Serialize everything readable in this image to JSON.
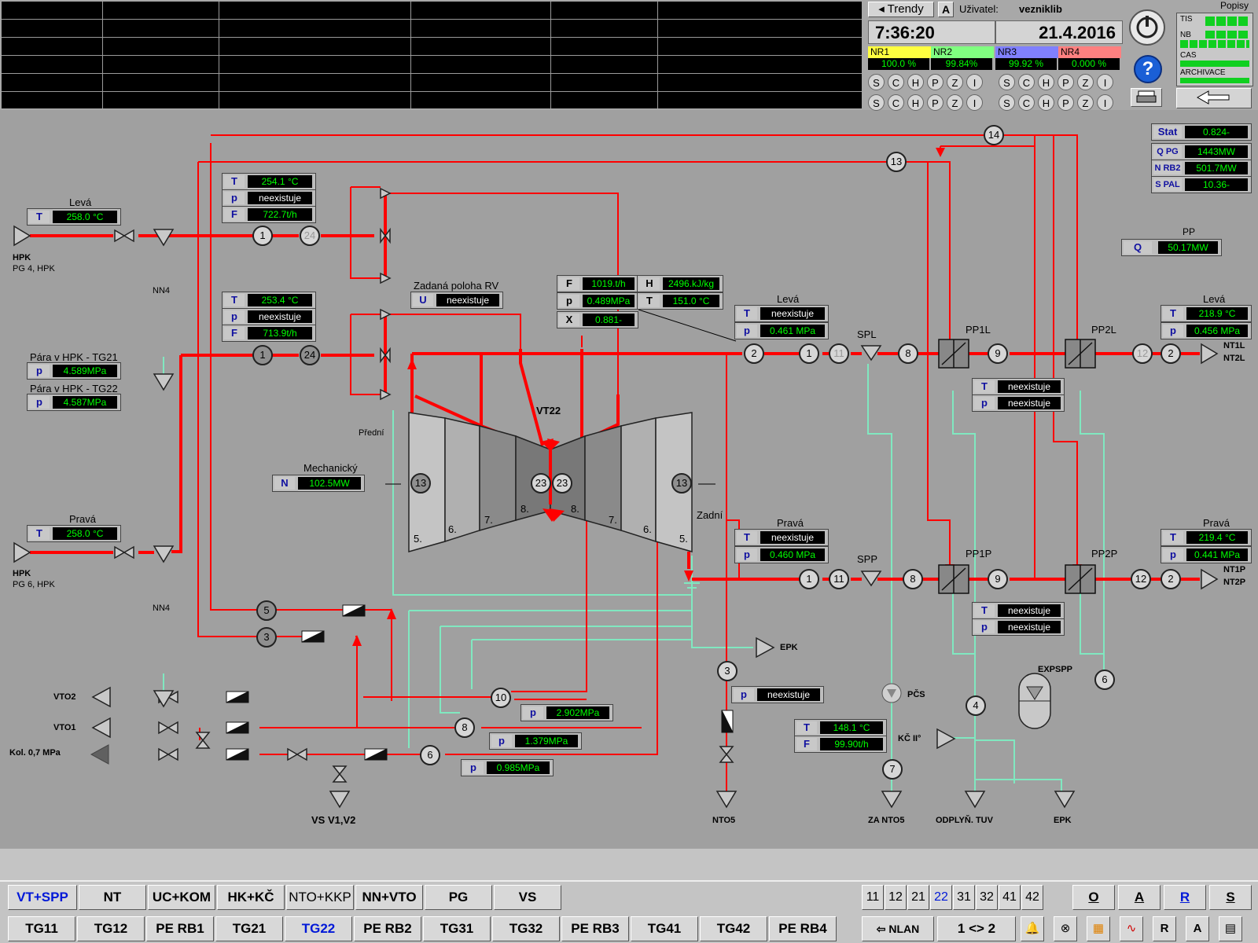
{
  "header": {
    "trendy": "◂ Trendy",
    "a_btn": "A",
    "user_label": "Uživatel:",
    "user_name": "vezniklib",
    "time": "7:36:20",
    "date": "21.4.2016",
    "popisy": "Popisy",
    "nr": [
      {
        "label": "NR1",
        "value": "100.0 %",
        "color": "#ffff40"
      },
      {
        "label": "NR2",
        "value": "99.84%",
        "color": "#80ff80"
      },
      {
        "label": "NR3",
        "value": "99.92 %",
        "color": "#8080ff"
      },
      {
        "label": "NR4",
        "value": "0.000 %",
        "color": "#ff8080"
      }
    ],
    "sch": [
      "S",
      "C",
      "H",
      "P",
      "Z",
      "I"
    ],
    "status_labels": [
      "TIS",
      "NB",
      "CAS",
      "ARCHIVACE"
    ]
  },
  "schema": {
    "stat": {
      "tag": "Stat",
      "value": "0.824-"
    },
    "qpg": {
      "tag": "Q PG",
      "value": "1443MW"
    },
    "nrb2": {
      "tag": "N RB2",
      "value": "501.7MW"
    },
    "spal": {
      "tag": "S PAL",
      "value": "10.36-"
    },
    "pp": {
      "label": "PP",
      "tag": "Q",
      "value": "50.17MW"
    },
    "levaTop": {
      "label": "Levá",
      "tag": "T",
      "value": "258.0 °C"
    },
    "hpk1": "HPK",
    "hpk1sub": "PG 4, HPK",
    "nn4a": "NN4",
    "pravaLeft": {
      "label": "Pravá",
      "tag": "T",
      "value": "258.0 °C"
    },
    "hpk2": "HPK",
    "hpk2sub": "PG 6, HPK",
    "nn4b": "NN4",
    "blk1": [
      {
        "tag": "T",
        "value": "254.1 °C"
      },
      {
        "tag": "p",
        "value": "neexistuje"
      },
      {
        "tag": "F",
        "value": "722.7t/h"
      }
    ],
    "blk2": [
      {
        "tag": "T",
        "value": "253.4 °C"
      },
      {
        "tag": "p",
        "value": "neexistuje"
      },
      {
        "tag": "F",
        "value": "713.9t/h"
      }
    ],
    "paraTG21": {
      "label": "Pára v HPK - TG21",
      "tag": "p",
      "value": "4.589MPa"
    },
    "paraTG22": {
      "label": "Pára v HPK - TG22",
      "tag": "p",
      "value": "4.587MPa"
    },
    "zadana": {
      "label": "Zadaná poloha RV",
      "tag": "U",
      "value": "neexistuje"
    },
    "center": [
      {
        "tag": "F",
        "value": "1019.t/h"
      },
      {
        "tag": "H",
        "value": "2496.kJ/kg"
      },
      {
        "tag": "p",
        "value": "0.489MPa"
      },
      {
        "tag": "T",
        "value": "151.0 °C"
      },
      {
        "tag": "X",
        "value": "0.881-"
      }
    ],
    "turbine": "VT22",
    "predni": "Přední",
    "zadni": "Zadní",
    "mech": {
      "label": "Mechanický",
      "tag": "N",
      "value": "102.5MW"
    },
    "stages": [
      "5.",
      "6.",
      "7.",
      "8.",
      "8.",
      "7.",
      "6.",
      "5."
    ],
    "levaMid": {
      "label": "Levá",
      "t": "neexistuje",
      "p": "0.461 MPa"
    },
    "pravaMid": {
      "label": "Pravá",
      "t": "neexistuje",
      "p": "0.460 MPa"
    },
    "spl": "SPL",
    "spp": "SPP",
    "pp1l": "PP1L",
    "pp2l": "PP2L",
    "pp1p": "PP1P",
    "pp2p": "PP2P",
    "levaRight": {
      "label": "Levá",
      "t": "218.9 °C",
      "p": "0.456 MPa"
    },
    "pravaRight": {
      "label": "Pravá",
      "t": "219.4 °C",
      "p": "0.441 MPa"
    },
    "nt1l": "NT1L",
    "nt2l": "NT2L",
    "nt1p": "NT1P",
    "nt2p": "NT2P",
    "neex1": {
      "t": "neexistuje",
      "p": "neexistuje"
    },
    "neex2": {
      "t": "neexistuje",
      "p": "neexistuje"
    },
    "p2902": {
      "tag": "p",
      "value": "2.902MPa"
    },
    "p1379": {
      "tag": "p",
      "value": "1.379MPa"
    },
    "p0985": {
      "tag": "p",
      "value": "0.985MPa"
    },
    "p3": {
      "tag": "p",
      "value": "neexistuje"
    },
    "tf": {
      "t": "148.1 °C",
      "f": "99.90t/h"
    },
    "epk1": "EPK",
    "epk2": "EPK",
    "vto2": "VTO2",
    "vto1": "VTO1",
    "kol": "Kol. 0,7 MPa",
    "vs": "VS V1,V2",
    "nto5": "NTO5",
    "zanto5": "ZA NTO5",
    "odplyn": "ODPLYŇ. TUV",
    "pcs": "PČS",
    "kc": "KČ II°",
    "expspp": "EXPSPP"
  },
  "bottom": {
    "row1": [
      "VT+SPP",
      "NT",
      "UC+KOM",
      "HK+KČ",
      "NTO+KKP",
      "NN+VTO",
      "PG",
      "VS"
    ],
    "row2": [
      "TG11",
      "TG12",
      "PE RB1",
      "TG21",
      "TG22",
      "PE RB2",
      "TG31",
      "TG32",
      "PE RB3",
      "TG41",
      "TG42",
      "PE RB4"
    ],
    "units": [
      "11",
      "12",
      "21",
      "22",
      "31",
      "32",
      "41",
      "42"
    ],
    "oars": [
      "O",
      "A",
      "R",
      "S"
    ],
    "nlan": "NLAN",
    "swap": "1 <> 2"
  }
}
